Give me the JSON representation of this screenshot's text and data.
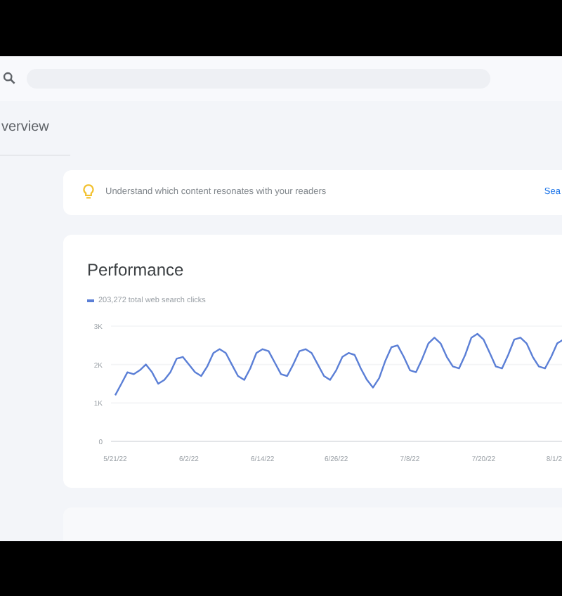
{
  "header": {
    "title": "verview"
  },
  "insight": {
    "text": "Understand which content resonates with your readers",
    "link": "Sea"
  },
  "performance": {
    "title": "Performance",
    "chart_data": {
      "type": "line",
      "categories": [
        "5/21/22",
        null,
        null,
        null,
        null,
        null,
        null,
        null,
        null,
        null,
        null,
        null,
        "6/2/22",
        null,
        null,
        null,
        null,
        null,
        null,
        null,
        null,
        null,
        null,
        null,
        "6/14/22",
        null,
        null,
        null,
        null,
        null,
        null,
        null,
        null,
        null,
        null,
        null,
        "6/26/22",
        null,
        null,
        null,
        null,
        null,
        null,
        null,
        null,
        null,
        null,
        null,
        "7/8/22",
        null,
        null,
        null,
        null,
        null,
        null,
        null,
        null,
        null,
        null,
        null,
        "7/20/22",
        null,
        null,
        null,
        null,
        null,
        null,
        null,
        null,
        null,
        null,
        null,
        "8/1/2",
        null
      ],
      "series": [
        {
          "name": "203,272 total web search clicks",
          "color": "#5b7fd6",
          "values": [
            1200,
            1500,
            1800,
            1750,
            1850,
            2000,
            1800,
            1500,
            1600,
            1800,
            2150,
            2200,
            2000,
            1800,
            1700,
            1950,
            2300,
            2400,
            2300,
            2000,
            1700,
            1600,
            1900,
            2300,
            2400,
            2350,
            2050,
            1750,
            1700,
            2000,
            2350,
            2400,
            2300,
            2000,
            1700,
            1600,
            1850,
            2200,
            2300,
            2250,
            1900,
            1600,
            1400,
            1650,
            2100,
            2450,
            2500,
            2200,
            1850,
            1800,
            2150,
            2550,
            2700,
            2550,
            2200,
            1950,
            1900,
            2250,
            2700,
            2800,
            2650,
            2300,
            1950,
            1900,
            2250,
            2650,
            2700,
            2550,
            2200,
            1950,
            1900,
            2200,
            2550,
            2650
          ]
        }
      ],
      "ylim": [
        0,
        3000
      ],
      "yticks": [
        {
          "value": 0,
          "label": "0"
        },
        {
          "value": 1000,
          "label": "1K"
        },
        {
          "value": 2000,
          "label": "2K"
        },
        {
          "value": 3000,
          "label": "3K"
        }
      ]
    }
  }
}
